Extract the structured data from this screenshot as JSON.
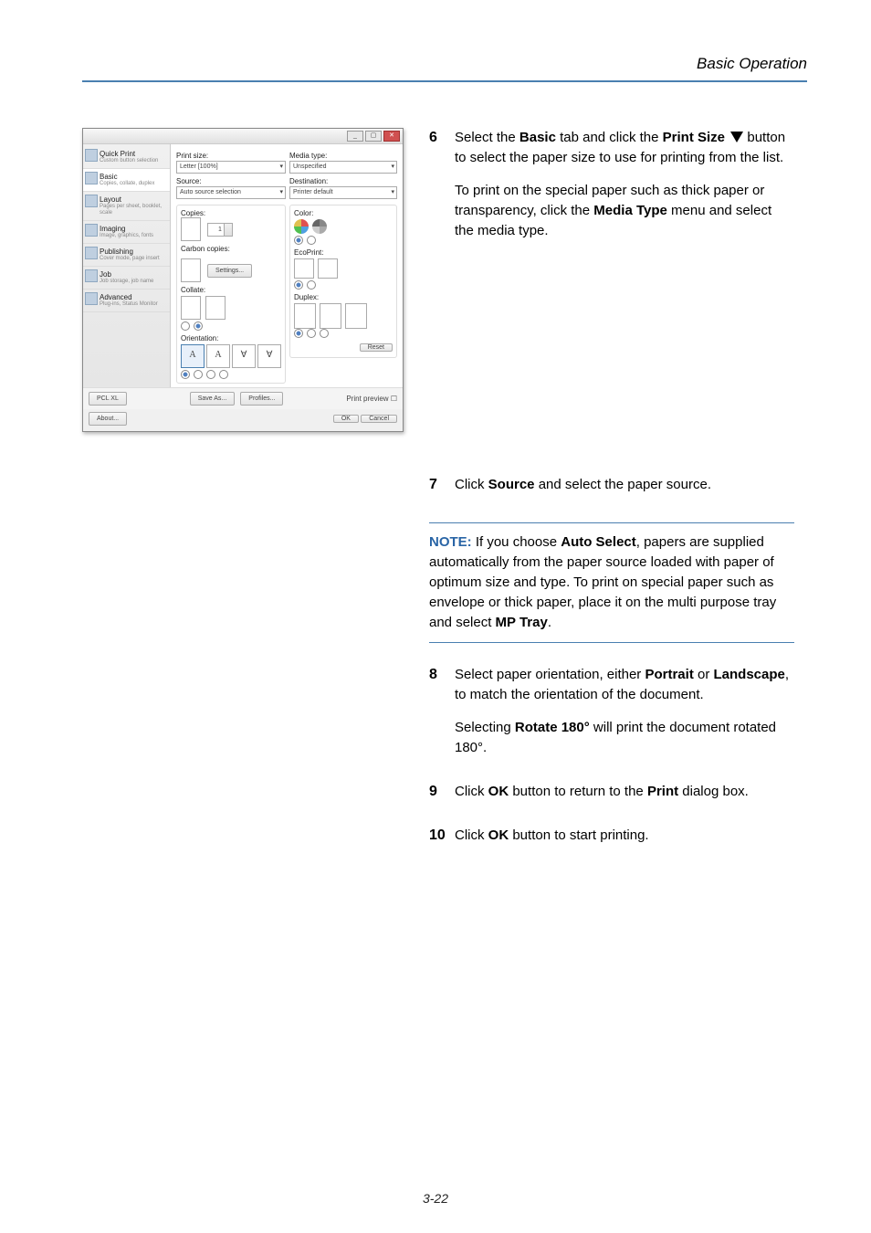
{
  "header": {
    "title": "Basic Operation"
  },
  "dialog": {
    "sidebar": [
      {
        "title": "Quick Print",
        "sub": "Custom button selection"
      },
      {
        "title": "Basic",
        "sub": "Copies, collate, duplex"
      },
      {
        "title": "Layout",
        "sub": "Pages per sheet, booklet, scale"
      },
      {
        "title": "Imaging",
        "sub": "Image, graphics, fonts"
      },
      {
        "title": "Publishing",
        "sub": "Cover mode, page insert"
      },
      {
        "title": "Job",
        "sub": "Job storage, job name"
      },
      {
        "title": "Advanced",
        "sub": "Plug-ins, Status Monitor"
      }
    ],
    "labels": {
      "print_size": "Print size:",
      "print_size_val": "Letter [100%]",
      "source": "Source:",
      "source_val": "Auto source selection",
      "copies": "Copies:",
      "copies_val": "1",
      "carbon": "Carbon copies:",
      "settings": "Settings...",
      "collate": "Collate:",
      "orientation": "Orientation:",
      "media_type": "Media type:",
      "media_type_val": "Unspecified",
      "destination": "Destination:",
      "destination_val": "Printer default",
      "color": "Color:",
      "ecoprint": "EcoPrint:",
      "duplex": "Duplex:",
      "reset": "Reset",
      "pcl": "PCL XL",
      "saveas": "Save As...",
      "profiles": "Profiles...",
      "printpreview": "Print preview",
      "about": "About...",
      "ok": "OK",
      "cancel": "Cancel"
    }
  },
  "steps": {
    "s6": {
      "num": "6",
      "p1a": "Select the ",
      "p1b": "Basic",
      "p1c": " tab and click the ",
      "p1d": "Print Size",
      "p1e": " button to select the paper size to use for printing from the list.",
      "p2a": "To print on the special paper such as thick paper or transparency, click the ",
      "p2b": "Media Type",
      "p2c": " menu and select the media type."
    },
    "s7": {
      "num": "7",
      "p1a": "Click ",
      "p1b": "Source",
      "p1c": " and select the paper source."
    },
    "note": {
      "label": "NOTE:",
      "t1": " If you choose ",
      "b1": "Auto Select",
      "t2": ", papers are supplied automatically from the paper source loaded with paper of optimum size and type. To print on special paper such as envelope or thick paper, place it on the multi purpose tray and select ",
      "b2": "MP Tray",
      "t3": "."
    },
    "s8": {
      "num": "8",
      "p1a": "Select paper orientation, either ",
      "p1b": "Portrait",
      "p1c": " or ",
      "p1d": "Landscape",
      "p1e": ", to match the orientation of the document.",
      "p2a": "Selecting ",
      "p2b": "Rotate 180°",
      "p2c": " will print the document rotated 180°."
    },
    "s9": {
      "num": "9",
      "p1a": "Click ",
      "p1b": "OK",
      "p1c": " button to return to the ",
      "p1d": "Print",
      "p1e": " dialog box."
    },
    "s10": {
      "num": "10",
      "p1a": "Click ",
      "p1b": "OK",
      "p1c": " button to start printing."
    }
  },
  "footer": {
    "pagenum": "3-22"
  }
}
